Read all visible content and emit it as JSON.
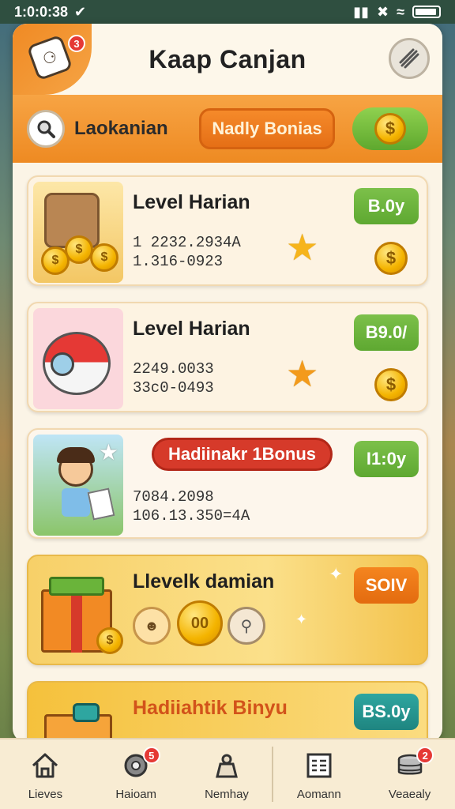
{
  "status_bar": {
    "time": "1:0:0:38"
  },
  "header": {
    "title": "Kaap Canjan",
    "dice_badge": "3"
  },
  "toolbar": {
    "search_label": "Laokanian",
    "bonus_button": "Nadly Bonias"
  },
  "cards": [
    {
      "title": "Level Harian",
      "line1": "1 2232.2934A",
      "line2": "1.316-0923",
      "value": "B.0y",
      "value_color": "green"
    },
    {
      "title": "Level Harian",
      "line1": "2249.0033",
      "line2": "33c0-0493",
      "value": "B9.0/",
      "value_color": "green"
    },
    {
      "pill": "Hadiinakr 1Bonus",
      "line1": "7084.2098",
      "line2": "106.13.350=4A",
      "value": "I1:0y",
      "value_color": "green"
    },
    {
      "title": "Llevelk damian",
      "value": "SOIV",
      "value_color": "orange",
      "coin_text": "00"
    },
    {
      "title": "Hadiiahtik Binyu",
      "value": "BS.0y",
      "value_color": "teal"
    }
  ],
  "bottom_nav": {
    "items": [
      {
        "label": "Lieves",
        "icon": "home-icon"
      },
      {
        "label": "Haioam",
        "icon": "gear-icon",
        "badge": "5"
      },
      {
        "label": "Nemhay",
        "icon": "bag-icon"
      },
      {
        "label": "Aomann",
        "icon": "calendar-icon"
      },
      {
        "label": "Veaealy",
        "icon": "coin-stack-icon",
        "badge": "2"
      }
    ]
  },
  "colors": {
    "accent": "#f08a24",
    "green": "#6ab43a",
    "orange": "#e97516",
    "teal": "#23928d",
    "red": "#d63a2a"
  }
}
